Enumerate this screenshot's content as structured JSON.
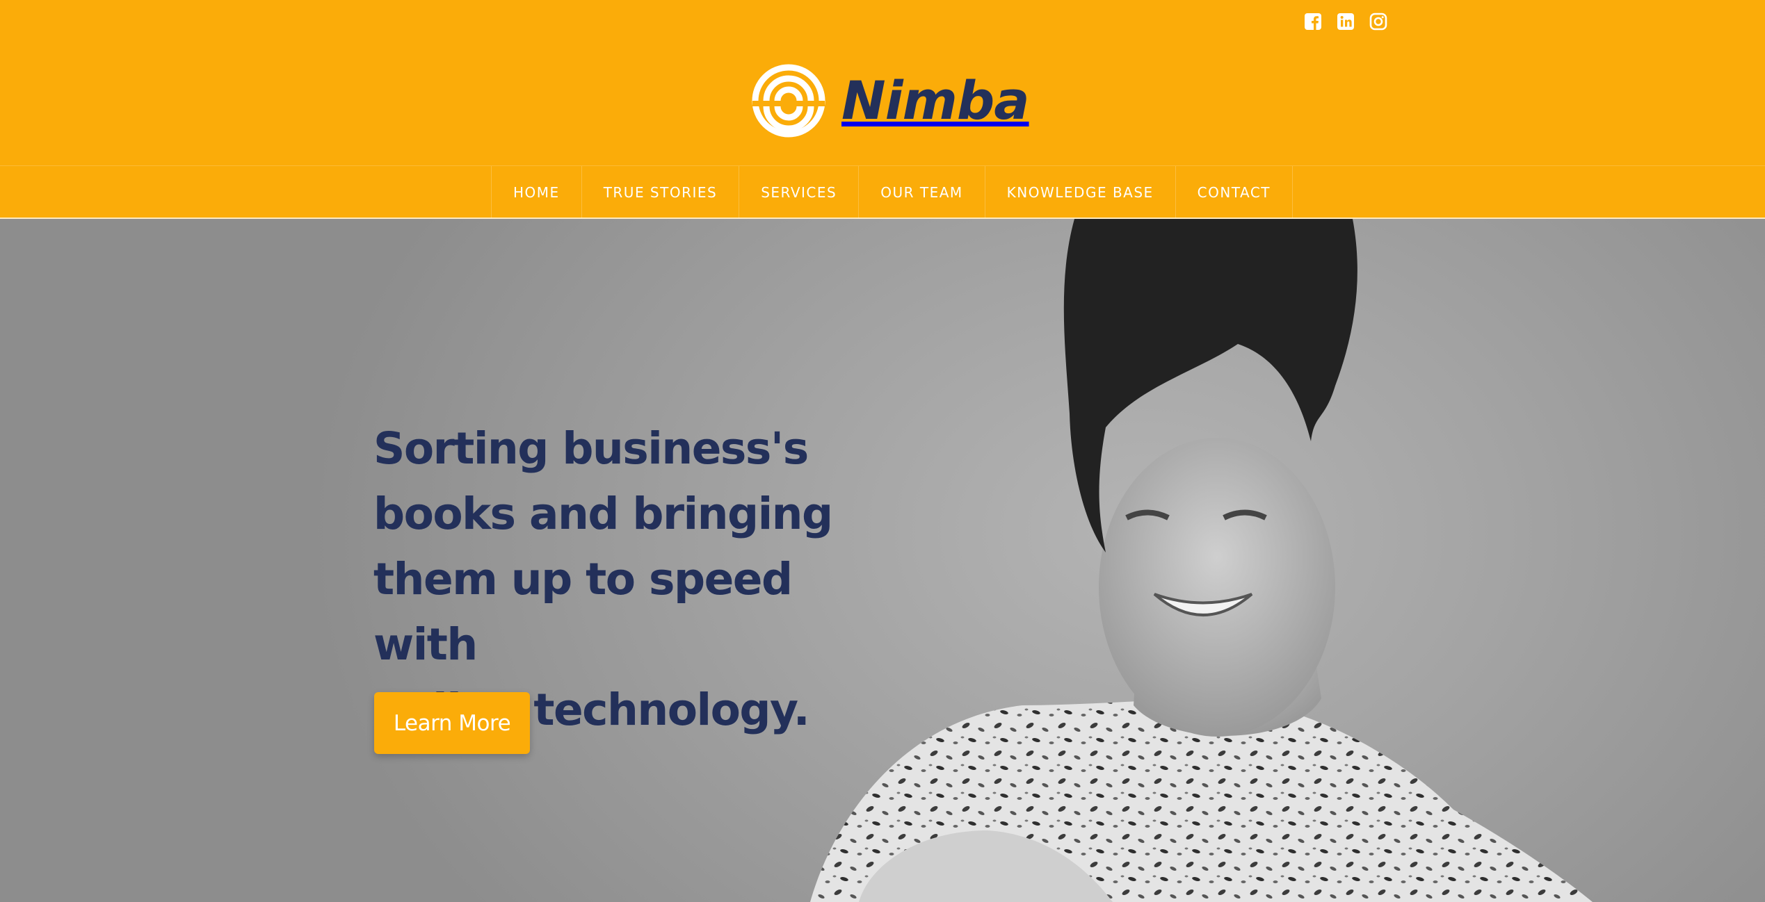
{
  "brand": {
    "name": "Nimba",
    "logo_icon": "nimba-swirl-logo-icon",
    "color": "#fbac09",
    "text_color": "#23305a"
  },
  "social": [
    {
      "name": "facebook",
      "icon": "facebook-icon"
    },
    {
      "name": "linkedin",
      "icon": "linkedin-icon"
    },
    {
      "name": "instagram",
      "icon": "instagram-icon"
    }
  ],
  "nav": {
    "items": [
      {
        "label": "HOME"
      },
      {
        "label": "TRUE STORIES"
      },
      {
        "label": "SERVICES"
      },
      {
        "label": "OUR TEAM"
      },
      {
        "label": "KNOWLEDGE BASE"
      },
      {
        "label": "CONTACT"
      }
    ]
  },
  "hero": {
    "headline_lines": [
      "Sorting business's",
      "books and bringing",
      "them up to speed with",
      "online technology."
    ],
    "cta_label": "Learn More",
    "image": "black-and-white-photo-smiling-woman-leopard-print-top"
  }
}
